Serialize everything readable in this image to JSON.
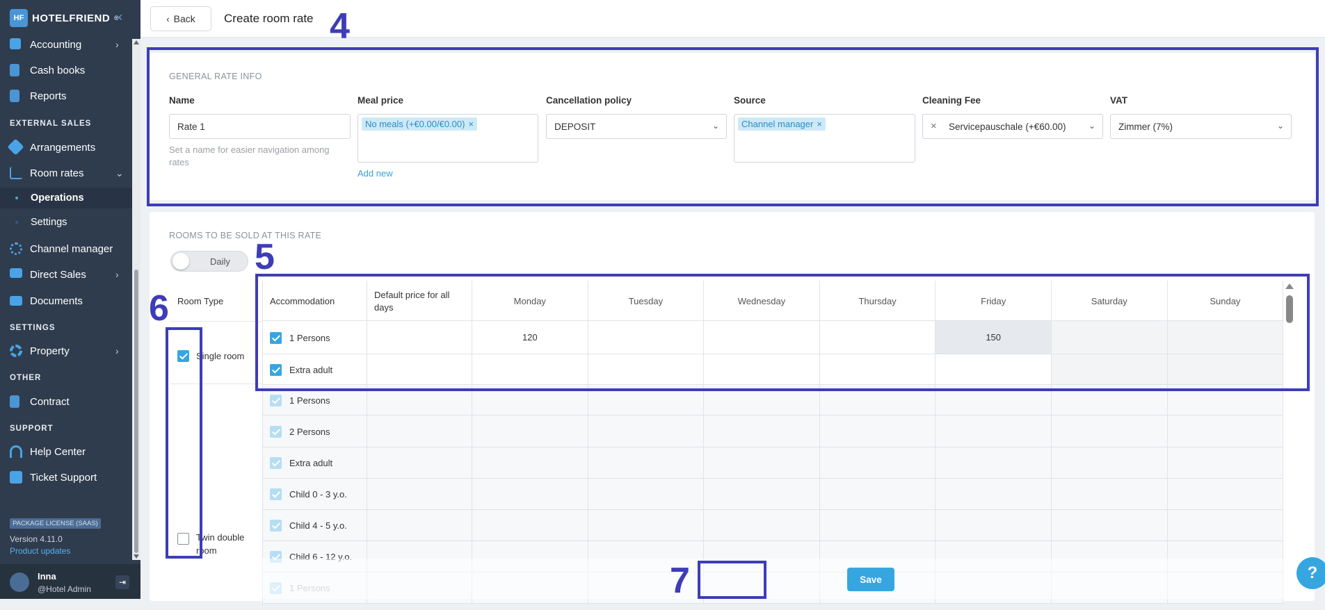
{
  "app": {
    "brand": "HOTELFRIEND",
    "brand_mark": "®",
    "logo_letters": "HF"
  },
  "sidebar": {
    "items": [
      {
        "label": "Accounting",
        "icon": "accounting-icon"
      },
      {
        "label": "Cash books",
        "icon": "book-icon"
      },
      {
        "label": "Reports",
        "icon": "clipboard-icon"
      },
      {
        "label": "Arrangements",
        "icon": "tag-icon"
      },
      {
        "label": "Room rates",
        "icon": "chart-icon"
      },
      {
        "label": "Channel manager",
        "icon": "network-icon"
      },
      {
        "label": "Direct Sales",
        "icon": "easel-icon"
      },
      {
        "label": "Documents",
        "icon": "folder-icon"
      },
      {
        "label": "Property",
        "icon": "gear-icon"
      },
      {
        "label": "Contract",
        "icon": "contract-icon"
      },
      {
        "label": "Help Center",
        "icon": "headset-icon"
      },
      {
        "label": "Ticket Support",
        "icon": "chat-icon"
      }
    ],
    "sections": {
      "external_sales": "EXTERNAL SALES",
      "settings": "SETTINGS",
      "other": "OTHER",
      "support": "SUPPORT"
    },
    "subitems": {
      "operations": "Operations",
      "settings": "Settings"
    },
    "license": "PACKAGE LICENSE (SAAS)",
    "version": "Version 4.11.0",
    "product_updates": "Product updates",
    "user": {
      "name": "Inna",
      "role": "@Hotel Admin"
    }
  },
  "header": {
    "back_label": "Back",
    "title": "Create room rate"
  },
  "annotations": {
    "a4": "4",
    "a5": "5",
    "a6": "6",
    "a7": "7"
  },
  "general": {
    "heading": "GENERAL RATE INFO",
    "name": {
      "label": "Name",
      "value": "Rate 1",
      "hint_line1": "Set a name for easier navigation among",
      "hint_line2": "rates"
    },
    "meal": {
      "label": "Meal price",
      "tag": "No meals (+€0.00/€0.00)",
      "add_new": "Add new"
    },
    "cancellation": {
      "label": "Cancellation policy",
      "value": "DEPOSIT"
    },
    "source": {
      "label": "Source",
      "tag": "Channel manager"
    },
    "cleaning": {
      "label": "Cleaning Fee",
      "value": "Servicepauschale (+€60.00)"
    },
    "vat": {
      "label": "VAT",
      "value": "Zimmer (7%)"
    }
  },
  "rooms": {
    "heading": "ROOMS TO BE SOLD AT THIS RATE",
    "toggle_label": "Daily",
    "room_type_header": "Room Type",
    "accommodation_header": "Accommodation",
    "default_price_line1": "Default price for all",
    "default_price_line2": "days",
    "days": [
      "Monday",
      "Tuesday",
      "Wednesday",
      "Thursday",
      "Friday",
      "Saturday",
      "Sunday"
    ],
    "room_types": [
      {
        "name_line1": "Single room",
        "name_line2": "",
        "checked": true
      },
      {
        "name_line1": "Twin double",
        "name_line2": "room",
        "checked": false
      }
    ],
    "rows": [
      {
        "acc": "1 Persons",
        "mon": "120",
        "fri": "150"
      },
      {
        "acc": "Extra adult"
      },
      {
        "acc": "1 Persons"
      },
      {
        "acc": "2 Persons"
      },
      {
        "acc": "Extra adult"
      },
      {
        "acc": "Child 0 - 3 y.o."
      },
      {
        "acc": "Child 4 - 5 y.o."
      },
      {
        "acc": "Child 6 - 12 y.o."
      },
      {
        "acc": "1 Persons"
      }
    ]
  },
  "footer": {
    "save_label": "Save"
  },
  "help_label": "?",
  "colors": {
    "sidebar": "#2f3c4e",
    "accent": "#36a6e0",
    "annotation": "#3d3db8"
  }
}
